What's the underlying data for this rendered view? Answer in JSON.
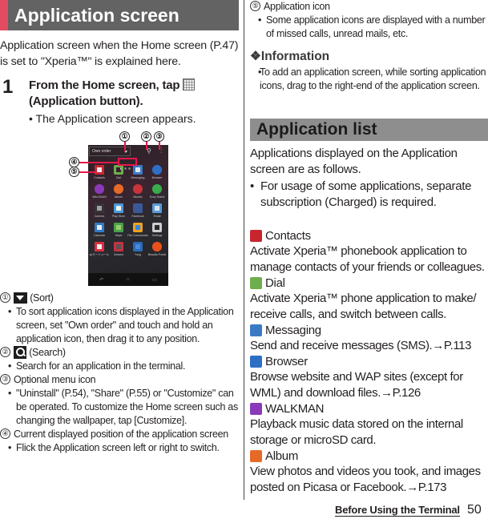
{
  "left": {
    "section_title": "Application screen",
    "intro": "Application screen when the Home screen (P.47) is set to \"Xperia™\" is explained here.",
    "step": {
      "number": "1",
      "text_before_icon": "From the Home screen, tap",
      "text_after_icon": "(Application button).",
      "icon": "app-grid-icon",
      "sub": "• The Application screen appears."
    },
    "phone": {
      "sort_label": "Own order",
      "callouts": [
        "①",
        "②",
        "③",
        "④",
        "⑤"
      ],
      "apps": [
        {
          "label": "Contacts",
          "color": "#c8262f",
          "bg": "#eeeeee"
        },
        {
          "label": "Dial",
          "color": "#6fae4c",
          "bg": "transparent"
        },
        {
          "label": "Messaging",
          "color": "#3a7ac4",
          "bg": "#dde6f2"
        },
        {
          "label": "Browser",
          "color": "#2d6fc4",
          "bg": "#2d6fc4"
        },
        {
          "label": "WALKMAN",
          "color": "#8a3ab8",
          "bg": "#8a3ab8"
        },
        {
          "label": "Album",
          "color": "#e56a28",
          "bg": "#e56a28"
        },
        {
          "label": "Movies",
          "color": "#c8343a",
          "bg": "#c8343a"
        },
        {
          "label": "Sony Select",
          "color": "#3aaa4a",
          "bg": "#3aaa4a"
        },
        {
          "label": "Camera",
          "color": "#333333",
          "bg": "#a0a0a0"
        },
        {
          "label": "Play Store",
          "color": "#4a9ad8",
          "bg": "#f0f0f0"
        },
        {
          "label": "Facebook",
          "color": "#3b5998",
          "bg": "#3b5998"
        },
        {
          "label": "Email",
          "color": "#5a9ad8",
          "bg": "#d8e6f4"
        },
        {
          "label": "Calendar",
          "color": "#2f7ac8",
          "bg": "#e8eef6"
        },
        {
          "label": "Maps",
          "color": "#4aa04a",
          "bg": "#9acb6a"
        },
        {
          "label": "File Commander",
          "color": "#f0a020",
          "bg": "#2f8ae0"
        },
        {
          "label": "Settings",
          "color": "#cccccc",
          "bg": "transparent"
        },
        {
          "label": "spモードメール",
          "color": "#d83040",
          "bg": "#f0f0f0"
        },
        {
          "label": "Infrared",
          "color": "#c83040",
          "bg": "#555555"
        },
        {
          "label": "Ysng",
          "color": "#2a6ab8",
          "bg": "#4a8ad8"
        },
        {
          "label": "Biscuits Portal",
          "color": "#e8501c",
          "bg": "#e8501c"
        }
      ],
      "nav_icons": [
        "back-icon",
        "home-icon",
        "recent-apps-icon"
      ]
    },
    "descriptions": [
      {
        "num": "①",
        "icon": "sort-icon",
        "title": "(Sort)",
        "bullets": [
          "To sort application icons displayed in the Application screen, set \"Own order\" and touch and hold an application icon, then drag it to any position."
        ]
      },
      {
        "num": "②",
        "icon": "search-icon",
        "title": "(Search)",
        "bullets": [
          "Search for an application in the terminal."
        ]
      },
      {
        "num": "③",
        "icon": "",
        "title": "Optional menu icon",
        "bullets": [
          "\"Uninstall\" (P.54), \"Share\" (P.55) or \"Customize\" can be operated. To customize the Home screen such as changing the wallpaper, tap [Customize]."
        ]
      },
      {
        "num": "④",
        "icon": "",
        "title": "Current displayed position of the application screen",
        "bullets": [
          "Flick the Application screen left or right to switch."
        ]
      }
    ]
  },
  "right": {
    "item5": {
      "num": "⑤",
      "title": "Application icon",
      "bullet": "Some application icons are displayed with a number of missed calls, unread mails, etc."
    },
    "information": {
      "title": "❖Information",
      "bullet": "To add an application screen, while sorting application icons, drag to the right-end of the application screen."
    },
    "section_title": "Application list",
    "list_intro": "Applications displayed on the Application screen are as follows.",
    "list_bullet": "For usage of some applications, separate subscription (Charged) is required.",
    "apps": [
      {
        "name": "Contacts",
        "icon": "contacts-icon",
        "color": "#c8262f",
        "desc": "Activate Xperia™ phonebook application to manage contacts of your friends or colleagues."
      },
      {
        "name": "Dial",
        "icon": "dial-icon",
        "color": "#6fae4c",
        "desc": "Activate Xperia™ phone application to make/ receive calls, and switch between calls."
      },
      {
        "name": "Messaging",
        "icon": "messaging-icon",
        "color": "#3a7ac4",
        "desc": "Send and receive messages (SMS).→P.113"
      },
      {
        "name": "Browser",
        "icon": "browser-icon",
        "color": "#2d6fc4",
        "desc": "Browse website and WAP sites (except for WML) and download files.→P.126"
      },
      {
        "name": "WALKMAN",
        "icon": "walkman-icon",
        "color": "#8a3ab8",
        "desc": "Playback music data stored on the internal storage or microSD card."
      },
      {
        "name": "Album",
        "icon": "album-icon",
        "color": "#e56a28",
        "desc": "View photos and videos you took, and images posted on Picasa or Facebook.→P.173"
      }
    ]
  },
  "footer": {
    "section": "Before Using the Terminal",
    "page": "50"
  },
  "colors": {
    "accent": "#e34b63",
    "header_dark": "#636363",
    "header_light": "#8e8e8e",
    "callout_red": "#e3194b"
  }
}
